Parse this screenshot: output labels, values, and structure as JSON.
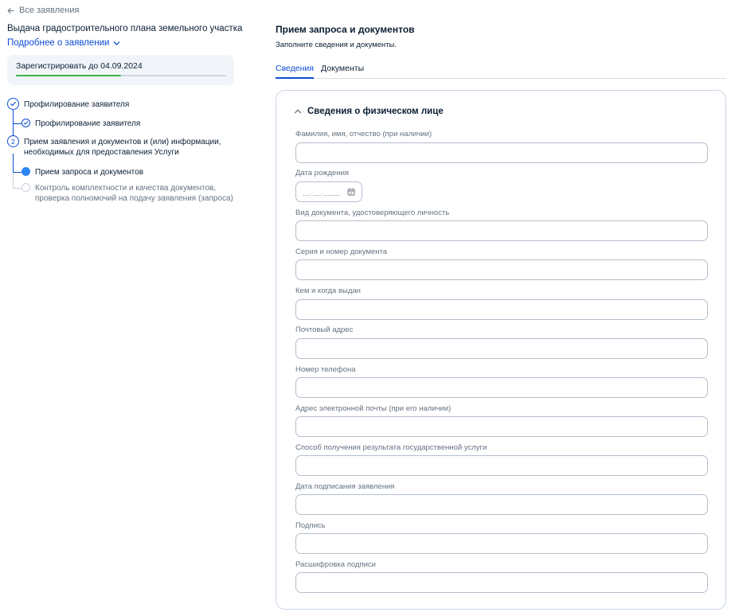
{
  "nav": {
    "back_label": "Все заявления"
  },
  "service": {
    "title": "Выдача градостроительного плана земельного участка",
    "more_label": "Подробнее о заявлении"
  },
  "deadline": {
    "text": "Зарегистрировать до 04.09.2024",
    "progress": 0.5,
    "progress_color": "#3ab34a"
  },
  "steps": {
    "step1": {
      "label": "Профилирование заявителя",
      "status": "done"
    },
    "step1_sub1": {
      "label": "Профилирование заявителя",
      "status": "done"
    },
    "step2": {
      "number": "2",
      "label_line1": "Прием заявления и документов и (или) информации,",
      "label_line2": "необходимых для предоставления Услуги"
    },
    "step2_sub1": {
      "label": "Прием запроса и документов",
      "status": "current"
    },
    "step2_sub2": {
      "label_line1": "Контроль комплектности и качества документов,",
      "label_line2": "проверка полномочий на подачу заявления (запроса)",
      "status": "pending"
    }
  },
  "main": {
    "title": "Прием запроса и документов",
    "subtitle": "Заполните сведения и документы.",
    "tabs": [
      {
        "label": "Сведения",
        "active": true
      },
      {
        "label": "Документы",
        "active": false
      }
    ]
  },
  "form": {
    "section_title": "Сведения о физическом лице",
    "fields": [
      {
        "label": "Фамилия, имя, отчество (при наличии)",
        "value": ""
      },
      {
        "label": "Дата рождения",
        "value": "",
        "placeholder": "__.__.____"
      },
      {
        "label": "Вид документа, удостоверяющего личность",
        "value": ""
      },
      {
        "label": "Серия и номер документа",
        "value": ""
      },
      {
        "label": "Кем и когда выдан",
        "value": ""
      },
      {
        "label": "Почтовый адрес",
        "value": ""
      },
      {
        "label": "Номер телефона",
        "value": ""
      },
      {
        "label": "Адрес электронной почты (при его наличии)",
        "value": ""
      },
      {
        "label": "Способ получения результата государственной услуги",
        "value": ""
      },
      {
        "label": "Дата подписания заявления",
        "value": ""
      },
      {
        "label": "Подпись",
        "value": ""
      },
      {
        "label": "Расшифровка подписи",
        "value": ""
      }
    ]
  },
  "colors": {
    "accent": "#0d4cd3",
    "current_step": "#2e86f5"
  },
  "icons": {
    "back": "arrow-left-icon",
    "more": "chevron-down-icon",
    "done": "check-icon",
    "section": "chevron-up-icon",
    "date": "calendar-icon"
  }
}
